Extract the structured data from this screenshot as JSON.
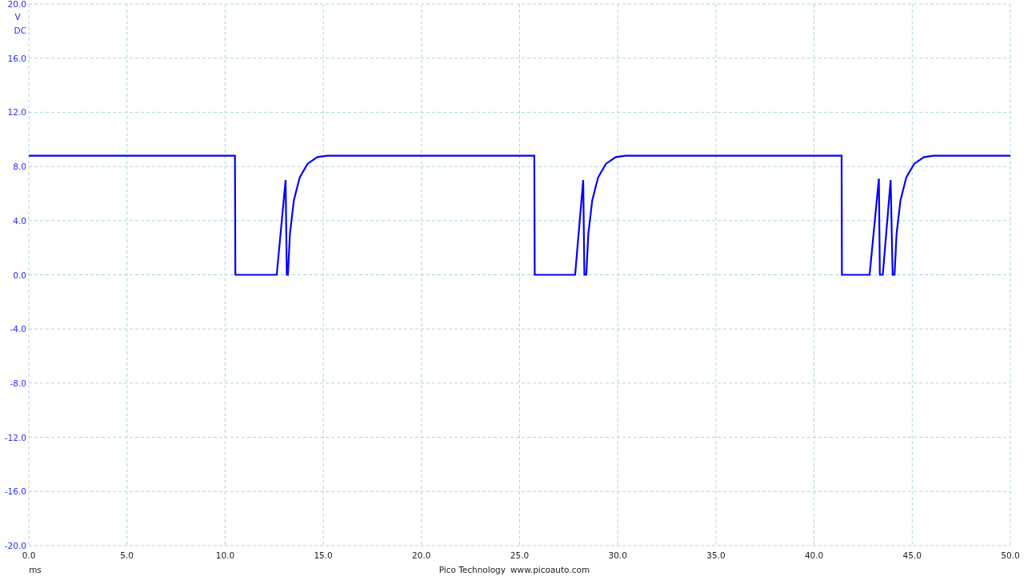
{
  "chart_data": {
    "type": "line",
    "grid": true,
    "xlabel": "ms",
    "ylabel": "V",
    "xlim": [
      0,
      50
    ],
    "ylim": [
      -20,
      20
    ],
    "xticks": [
      {
        "value": 0,
        "label": "0.0"
      },
      {
        "value": 5,
        "label": "5.0"
      },
      {
        "value": 10,
        "label": "10.0"
      },
      {
        "value": 15,
        "label": "15.0"
      },
      {
        "value": 20,
        "label": "20.0"
      },
      {
        "value": 25,
        "label": "25.0"
      },
      {
        "value": 30,
        "label": "30.0"
      },
      {
        "value": 35,
        "label": "35.0"
      },
      {
        "value": 40,
        "label": "40.0"
      },
      {
        "value": 45,
        "label": "45.0"
      },
      {
        "value": 50,
        "label": "50.0"
      }
    ],
    "yticks": [
      {
        "value": 20,
        "label": "20.0"
      },
      {
        "value": 16,
        "label": "16.0"
      },
      {
        "value": 12,
        "label": "12.0"
      },
      {
        "value": 8,
        "label": "8.0"
      },
      {
        "value": 4,
        "label": "4.0"
      },
      {
        "value": 0,
        "label": "0.0"
      },
      {
        "value": -4,
        "label": "-4.0"
      },
      {
        "value": -8,
        "label": "-8.0"
      },
      {
        "value": -12,
        "label": "-12.0"
      },
      {
        "value": -16,
        "label": "-16.0"
      },
      {
        "value": -20,
        "label": "-20.0"
      }
    ],
    "x": [
      0,
      10.5,
      10.52,
      12.63,
      13.08,
      13.14,
      13.2,
      13.3,
      13.5,
      13.8,
      14.2,
      14.7,
      15.2,
      25.75,
      25.77,
      27.83,
      28.24,
      28.3,
      28.4,
      28.5,
      28.7,
      29.0,
      29.4,
      29.9,
      30.4,
      41.4,
      41.42,
      42.83,
      43.3,
      43.35,
      43.5,
      43.9,
      44.0,
      44.1,
      44.2,
      44.4,
      44.7,
      45.1,
      45.6,
      46.1,
      50
    ],
    "series": [
      {
        "color": "#0000ff",
        "values": [
          8.8,
          8.8,
          0,
          0,
          7.0,
          0,
          0,
          3.0,
          5.5,
          7.2,
          8.2,
          8.7,
          8.8,
          8.8,
          0,
          0,
          7.0,
          0,
          0,
          3.0,
          5.5,
          7.2,
          8.2,
          8.7,
          8.8,
          8.8,
          0,
          0,
          7.1,
          0,
          0,
          7.0,
          0,
          0,
          3.0,
          5.5,
          7.2,
          8.2,
          8.7,
          8.8,
          8.8
        ]
      }
    ]
  },
  "coupling": "DC",
  "footer": {
    "company": "Pico Technology",
    "website": "www.picoauto.com"
  }
}
